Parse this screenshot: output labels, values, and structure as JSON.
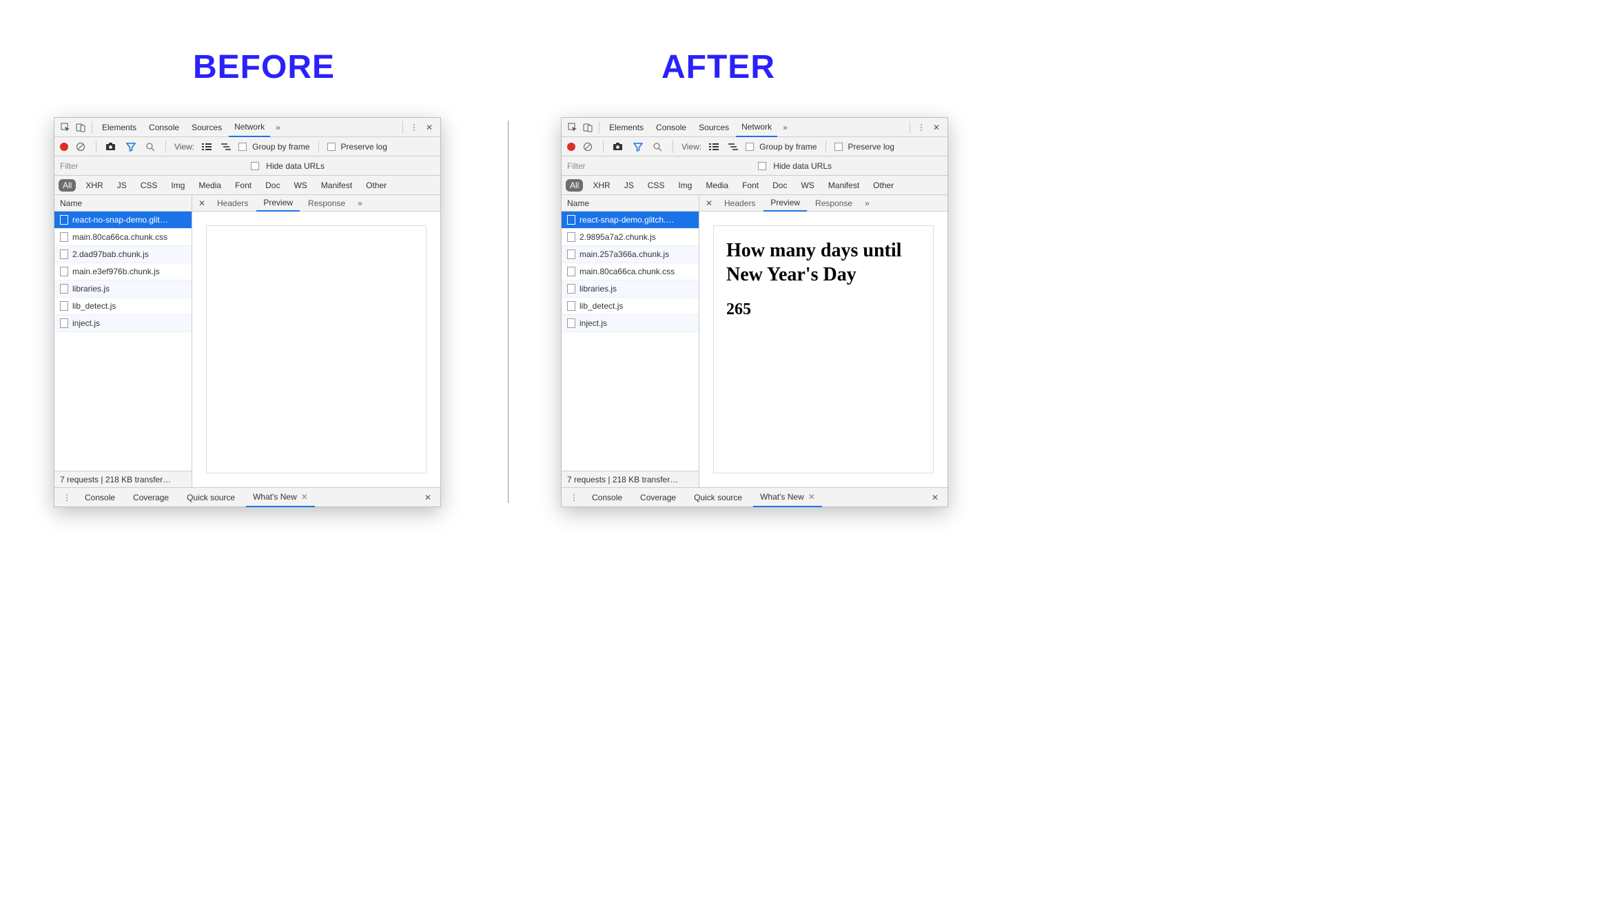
{
  "left_heading": "BEFORE",
  "right_heading": "AFTER",
  "top_tabs": {
    "elements": "Elements",
    "console": "Console",
    "sources": "Sources",
    "network": "Network",
    "active": "network"
  },
  "toolbar": {
    "view_label": "View:",
    "group_by_frame": "Group by frame",
    "preserve_log": "Preserve log"
  },
  "filter": {
    "placeholder": "Filter",
    "hide_data_urls": "Hide data URLs"
  },
  "types": [
    "All",
    "XHR",
    "JS",
    "CSS",
    "Img",
    "Media",
    "Font",
    "Doc",
    "WS",
    "Manifest",
    "Other"
  ],
  "types_active": "All",
  "requests_header": "Name",
  "detail_tabs": {
    "headers": "Headers",
    "preview": "Preview",
    "response": "Response",
    "active": "preview"
  },
  "drawer_tabs": {
    "console": "Console",
    "coverage": "Coverage",
    "quicksource": "Quick source",
    "whatsnew": "What's New",
    "active": "whatsnew"
  },
  "status_line": "7 requests | 218 KB transfer…",
  "before": {
    "requests": [
      "react-no-snap-demo.glit…",
      "main.80ca66ca.chunk.css",
      "2.dad97bab.chunk.js",
      "main.e3ef976b.chunk.js",
      "libraries.js",
      "lib_detect.js",
      "inject.js"
    ],
    "selected": 0,
    "preview_title": "",
    "preview_number": ""
  },
  "after": {
    "requests": [
      "react-snap-demo.glitch.…",
      "2.9895a7a2.chunk.js",
      "main.257a366a.chunk.js",
      "main.80ca66ca.chunk.css",
      "libraries.js",
      "lib_detect.js",
      "inject.js"
    ],
    "selected": 0,
    "preview_title": "How many days until New Year's Day",
    "preview_number": "265"
  }
}
